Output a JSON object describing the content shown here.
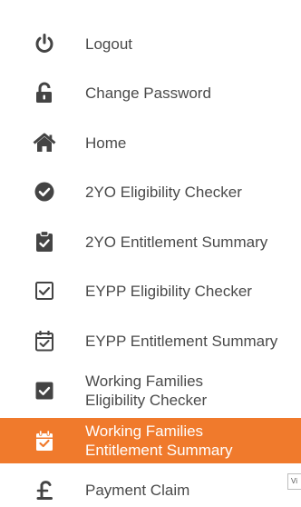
{
  "menu": {
    "items": [
      {
        "label": "Logout",
        "icon": "power-icon"
      },
      {
        "label": "Change Password",
        "icon": "unlock-icon"
      },
      {
        "label": "Home",
        "icon": "home-icon"
      },
      {
        "label": "2YO Eligibility Checker",
        "icon": "check-circle-icon"
      },
      {
        "label": "2YO Entitlement Summary",
        "icon": "clipboard-check-icon"
      },
      {
        "label": "EYPP Eligibility Checker",
        "icon": "check-square-outline-icon"
      },
      {
        "label": "EYPP Entitlement Summary",
        "icon": "calendar-check-outline-icon"
      },
      {
        "label": "Working Families\nEligibility Checker",
        "icon": "check-square-icon"
      },
      {
        "label": "Working Families\nEntitlement Summary",
        "icon": "calendar-check-icon",
        "active": true
      },
      {
        "label": "Payment Claim",
        "icon": "pound-icon"
      }
    ]
  },
  "side_stub": {
    "text": "Vi"
  },
  "colors": {
    "icon": "#444444",
    "label": "#4a4a4a",
    "active_background": "#f07a2c",
    "active_text": "#ffffff"
  }
}
